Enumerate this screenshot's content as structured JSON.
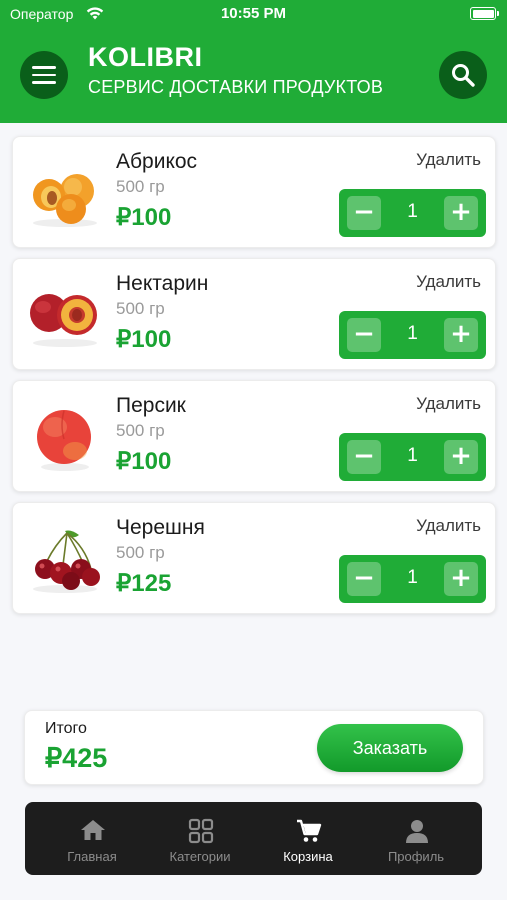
{
  "status_bar": {
    "carrier": "Оператор",
    "time": "10:55 PM"
  },
  "header": {
    "brand": "KOLIBRI",
    "tagline": "СЕРВИС ДОСТАВКИ ПРОДУКТОВ",
    "menu_icon": "hamburger-icon",
    "search_icon": "search-icon",
    "color": "#20ac37"
  },
  "cart": {
    "remove_label": "Удалить",
    "items": [
      {
        "name": "Абрикос",
        "weight": "500 гр",
        "price": "₽100",
        "qty": "1",
        "icon": "apricot-image"
      },
      {
        "name": "Нектарин",
        "weight": "500 гр",
        "price": "₽100",
        "qty": "1",
        "icon": "nectarine-image"
      },
      {
        "name": "Персик",
        "weight": "500 гр",
        "price": "₽100",
        "qty": "1",
        "icon": "peach-image"
      },
      {
        "name": "Черешня",
        "weight": "500 гр",
        "price": "₽125",
        "qty": "1",
        "icon": "cherry-image"
      }
    ],
    "minus_label": "−",
    "plus_label": "+"
  },
  "summary": {
    "label": "Итого",
    "total": "₽425",
    "order_button": "Заказать"
  },
  "tabbar": {
    "active": "Корзина",
    "tabs": [
      {
        "label": "Главная",
        "icon": "home-icon"
      },
      {
        "label": "Категории",
        "icon": "grid-icon"
      },
      {
        "label": "Корзина",
        "icon": "cart-icon"
      },
      {
        "label": "Профиль",
        "icon": "user-icon"
      }
    ]
  },
  "colors": {
    "accent": "#20ac37",
    "accent_dark": "#0a5f1a",
    "price": "#1aa333",
    "tabbar": "#1d1d1d"
  }
}
